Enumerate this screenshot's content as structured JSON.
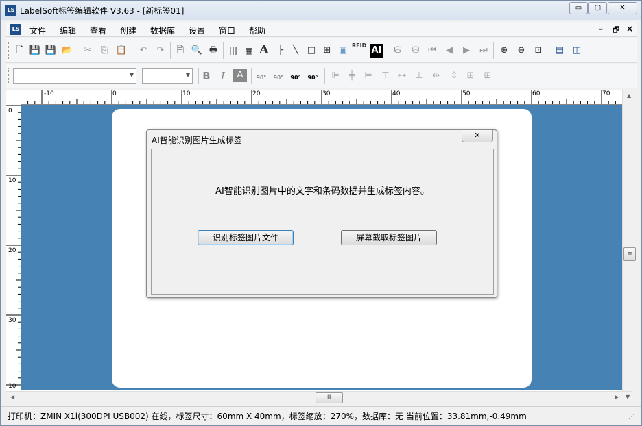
{
  "window": {
    "title": "LabelSoft标签编辑软件 V3.63 - [新标签01]",
    "controls": {
      "minimize": "▭",
      "maximize": "▢",
      "close": "✕"
    }
  },
  "menu": {
    "items": [
      "文件",
      "编辑",
      "查看",
      "创建",
      "数据库",
      "设置",
      "窗口",
      "帮助"
    ],
    "mdi": {
      "minimize": "–",
      "restore": "🗗",
      "close": "×"
    }
  },
  "toolbar": {
    "font_name": "",
    "font_size": "",
    "bold": "B",
    "italic": "I",
    "shadow": "A",
    "ai": "AI",
    "text_tool": "A",
    "rotate": [
      "90°",
      "90°",
      "90°",
      "90°"
    ],
    "rfid": "RFID"
  },
  "ruler": {
    "h_labels": [
      "-10",
      "0",
      "10",
      "20",
      "30",
      "40",
      "50",
      "60",
      "70"
    ],
    "v_labels": [
      "0",
      "10",
      "20",
      "30",
      "10"
    ]
  },
  "dialog": {
    "title": "AI智能识别图片生成标签",
    "close": "✕",
    "message": "AI智能识别图片中的文字和条码数据并生成标签内容。",
    "btn_recognize": "识别标签图片文件",
    "btn_capture": "屏幕截取标签图片"
  },
  "scroll": {
    "hthumb": "Ⅲ",
    "vthumb": "≡"
  },
  "status": {
    "text": "打印机：ZMIN X1i(300DPI USB002) 在线，标签尺寸：60mm X 40mm，标签缩放：270%，数据库：无  当前位置：33.81mm,-0.49mm"
  },
  "colors": {
    "canvas": "#4682b4",
    "paper": "#ffffff"
  }
}
